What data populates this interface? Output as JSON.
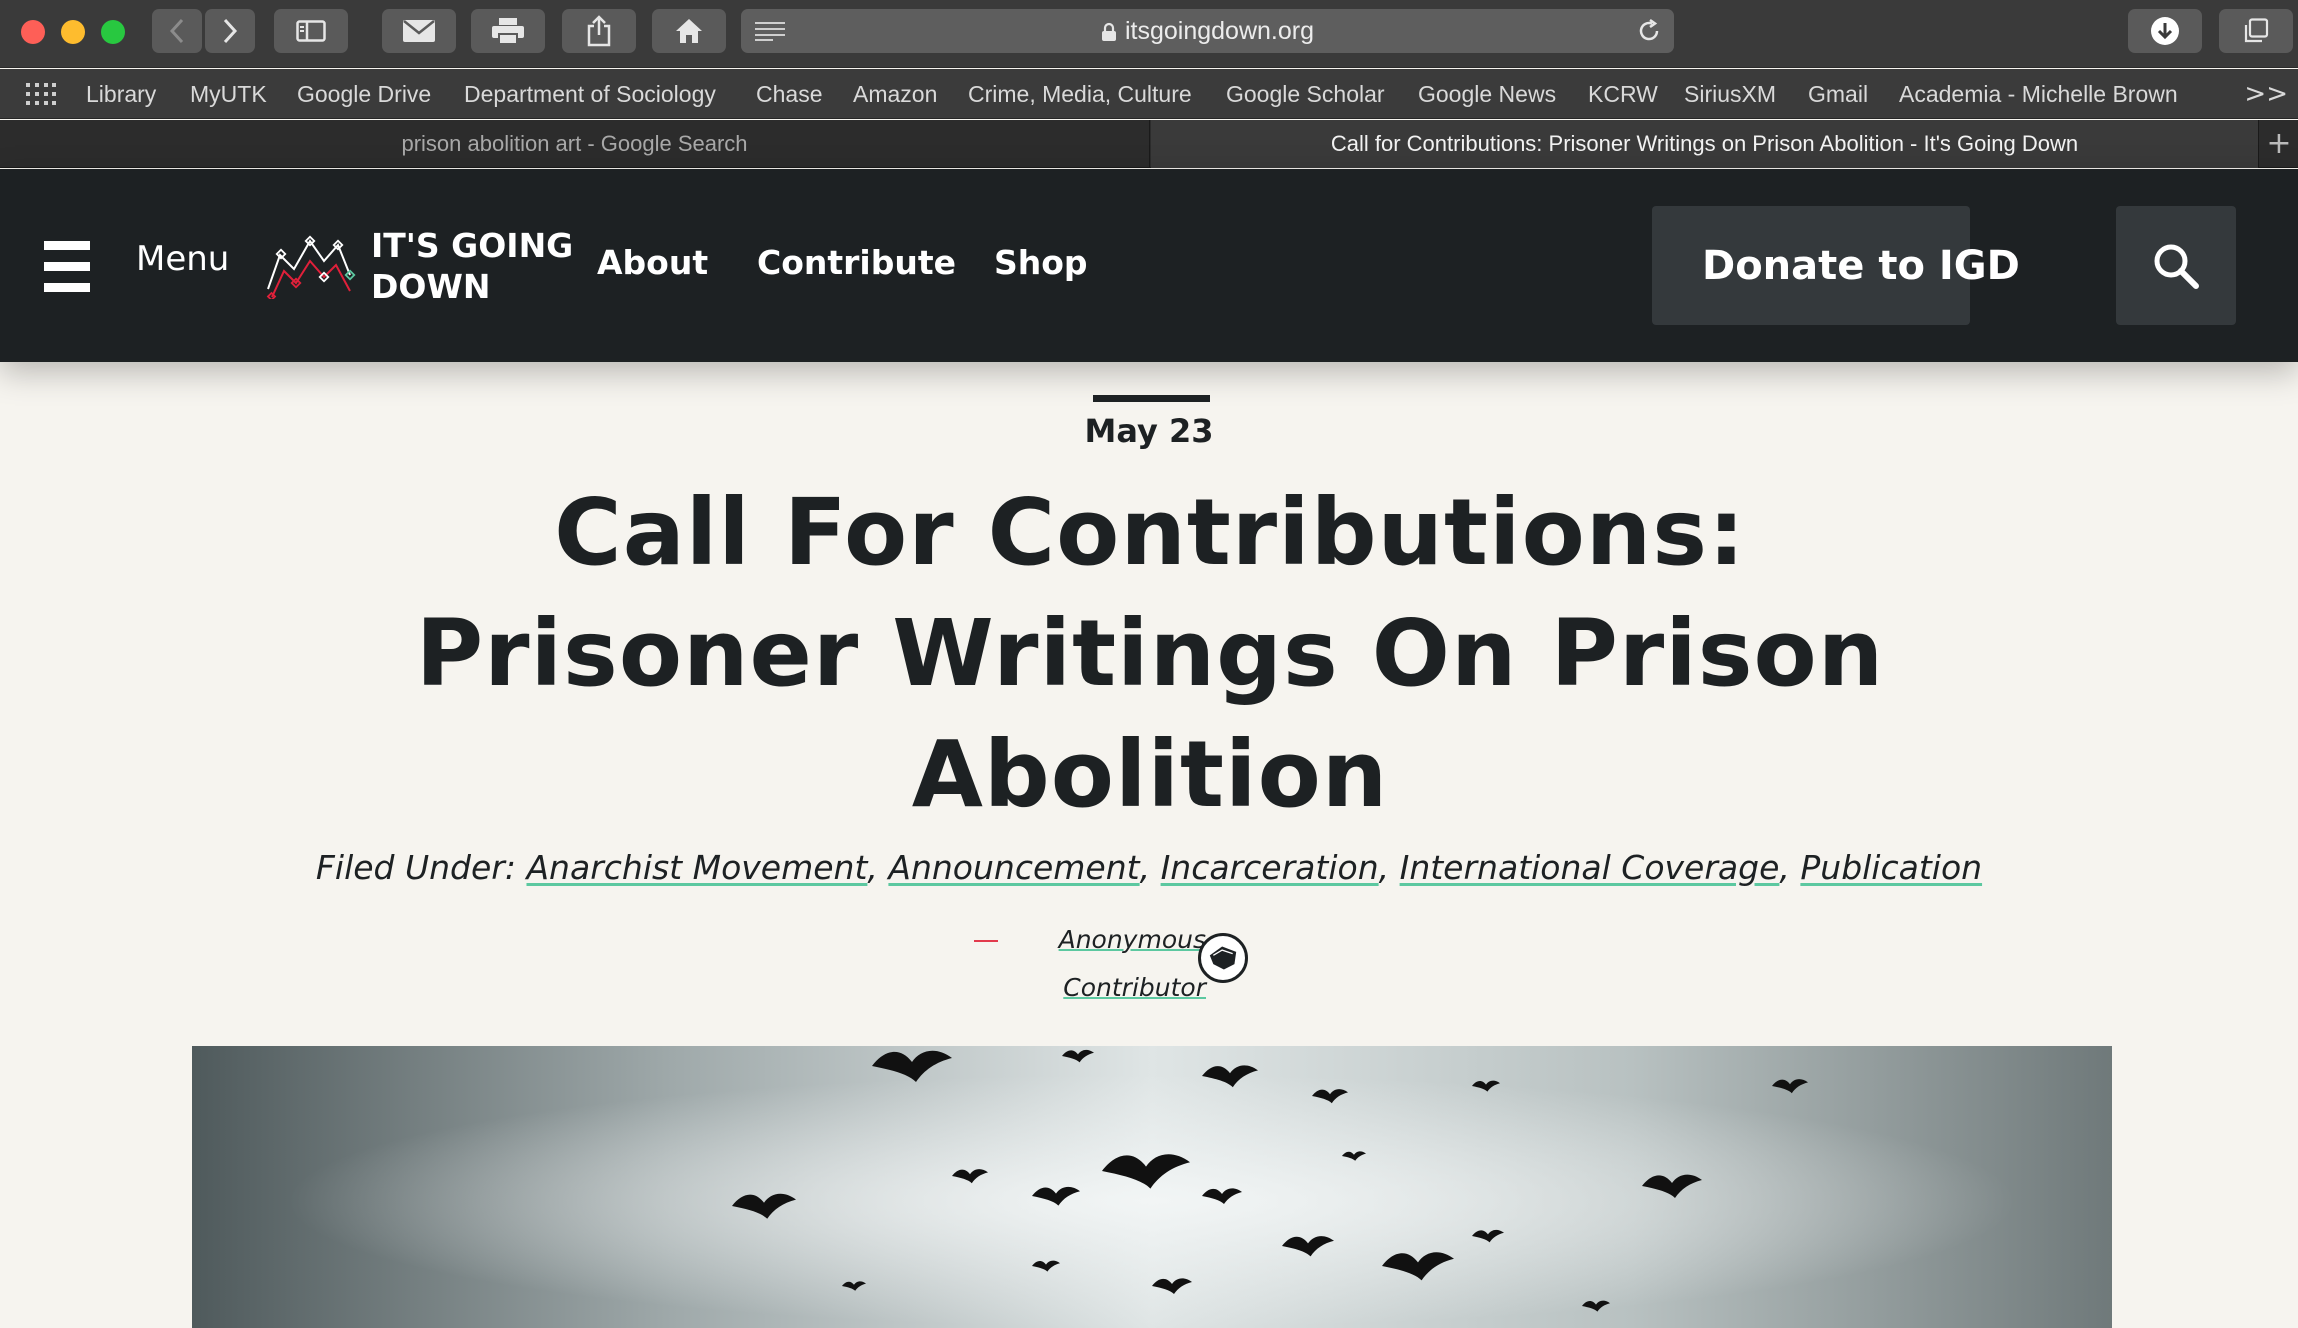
{
  "browser": {
    "url": "itsgoingdown.org",
    "bookmarks": [
      "Library",
      "MyUTK",
      "Google Drive",
      "Department of Sociology",
      "Chase",
      "Amazon",
      "Crime, Media, Culture",
      "Google Scholar",
      "Google News",
      "KCRW",
      "SiriusXM",
      "Gmail",
      "Academia - Michelle Brown"
    ],
    "bookmarks_overflow": ">>",
    "tabs": [
      {
        "title": "prison abolition art - Google Search",
        "active": false
      },
      {
        "title": "Call for Contributions: Prisoner Writings on Prison Abolition - It's Going Down",
        "active": true
      }
    ],
    "new_tab": "+"
  },
  "site": {
    "menu_label": "Menu",
    "logo_text": "IT'S GOING\nDOWN",
    "nav": [
      "About",
      "Contribute",
      "Shop"
    ],
    "donate_label": "Donate to IGD",
    "colors": {
      "header_bg": "#1d2123",
      "button_bg": "#34393c",
      "heart": "#e0203a",
      "accent_underline": "#5cc8a0"
    }
  },
  "article": {
    "date": "May 23",
    "title": "Call For Contributions: Prisoner Writings On Prison Abolition",
    "filed_under_label": "Filed Under:",
    "categories": [
      "Anarchist Movement",
      "Announcement",
      "Incarceration",
      "International Coverage",
      "Publication"
    ],
    "author_line1": "Anonymous",
    "author_line2": "Contributor"
  }
}
